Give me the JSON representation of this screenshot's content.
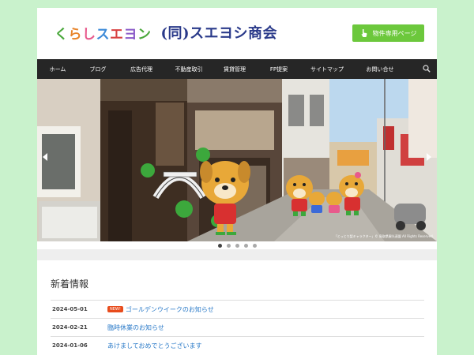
{
  "header": {
    "logo_part1_chars": [
      "く",
      "ら",
      "し",
      "ス",
      "エ",
      "ヨ",
      "ン"
    ],
    "logo_part2": "(同)スエヨシ商会",
    "member_button_label": "物件専用ページ"
  },
  "nav": {
    "items": [
      "ホーム",
      "ブログ",
      "広告代理",
      "不動産取引",
      "賃貸管理",
      "FP提案",
      "サイトマップ",
      "お問い合せ"
    ]
  },
  "slider": {
    "copyright": "「とっとり梨キャラクター」© 鳥取県観光連盟 All Rights Reserved.",
    "slide_count": 5,
    "active_index": 0
  },
  "news": {
    "title": "新着情報",
    "items": [
      {
        "date": "2024-05-01",
        "badge": "NEW!",
        "text": "ゴールデンウイークのお知らせ"
      },
      {
        "date": "2024-02-21",
        "badge": "",
        "text": "臨時休業のお知らせ"
      },
      {
        "date": "2024-01-06",
        "badge": "",
        "text": "あけましておめでとうございます"
      }
    ]
  },
  "colors": {
    "background": "#c9f2cc",
    "nav_bg": "#262626",
    "member_button": "#6cc83c",
    "link": "#2a7ac8",
    "new_badge": "#e84c1c"
  }
}
